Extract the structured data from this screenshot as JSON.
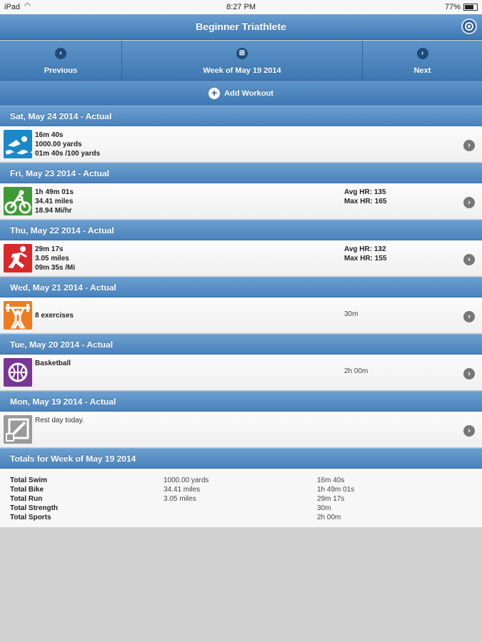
{
  "status": {
    "carrier": "iPad",
    "time": "8:27 PM",
    "battery": "77%"
  },
  "header": {
    "title": "Beginner Triathlete"
  },
  "nav": {
    "previous": "Previous",
    "week": "Week of May 19 2014",
    "next": "Next"
  },
  "add_workout": "Add Workout",
  "days": [
    {
      "header": "Sat, May 24 2014 - Actual",
      "icon": "swim-icon",
      "color": "#1a88c9",
      "lines": [
        "16m 40s",
        "1000.00 yards",
        "01m 40s /100 yards"
      ],
      "right": []
    },
    {
      "header": "Fri, May 23 2014 - Actual",
      "icon": "bike-icon",
      "color": "#3f9b35",
      "lines": [
        "1h 49m 01s",
        "34.41 miles",
        "18.94 Mi/hr"
      ],
      "right": [
        "Avg HR: 135",
        "Max HR: 165"
      ]
    },
    {
      "header": "Thu, May 22 2014 - Actual",
      "icon": "run-icon",
      "color": "#d9282a",
      "lines": [
        "29m 17s",
        "3.05 miles",
        "09m 35s /Mi"
      ],
      "right": [
        "Avg HR: 132",
        "Max HR: 155"
      ]
    },
    {
      "header": "Wed, May 21 2014 - Actual",
      "icon": "strength-icon",
      "color": "#ee7d22",
      "lines": [
        "",
        "8 exercises"
      ],
      "right": [
        "30m"
      ]
    },
    {
      "header": "Tue, May 20 2014 - Actual",
      "icon": "basketball-icon",
      "color": "#7a3596",
      "lines": [
        "Basketball"
      ],
      "right": [
        "2h 00m"
      ]
    },
    {
      "header": "Mon, May 19 2014 - Actual",
      "icon": "rest-day-icon",
      "color": "#9a9a9a",
      "lines": [
        "Rest day today."
      ],
      "right": []
    }
  ],
  "totals": {
    "header": "Totals for Week of May 19 2014",
    "labels": [
      "Total Swim",
      "Total Bike",
      "Total Run",
      "Total Strength",
      "Total Sports"
    ],
    "amounts": [
      "1000.00 yards",
      "34.41 miles",
      "3.05 miles",
      "",
      ""
    ],
    "times": [
      "16m 40s",
      "1h 49m 01s",
      "29m 17s",
      "30m",
      "2h 00m"
    ]
  }
}
